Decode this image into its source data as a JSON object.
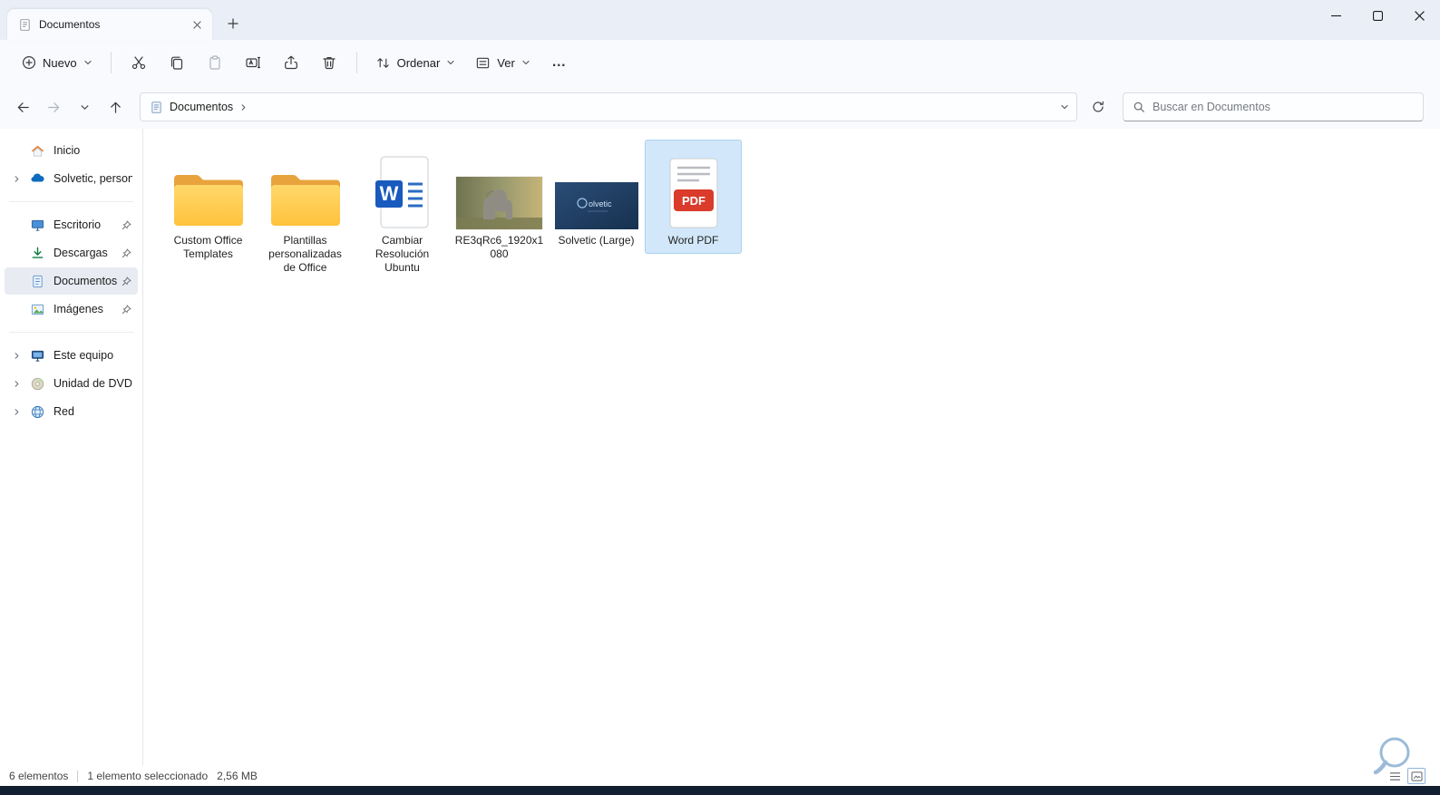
{
  "window": {
    "tab_title": "Documentos"
  },
  "toolbar": {
    "new_label": "Nuevo",
    "sort_label": "Ordenar",
    "view_label": "Ver",
    "more_label": "…"
  },
  "nav": {
    "breadcrumb": "Documentos",
    "search_placeholder": "Buscar en Documentos"
  },
  "sidebar": {
    "items": [
      {
        "label": "Inicio",
        "icon": "home-icon",
        "pinned": false
      },
      {
        "label": "Solvetic, personal",
        "icon": "onedrive-cloud-icon",
        "pinned": false
      },
      {
        "label": "Escritorio",
        "icon": "desktop-icon",
        "pinned": true
      },
      {
        "label": "Descargas",
        "icon": "downloads-icon",
        "pinned": true
      },
      {
        "label": "Documentos",
        "icon": "documents-icon",
        "pinned": true,
        "selected": true
      },
      {
        "label": "Imágenes",
        "icon": "pictures-icon",
        "pinned": true
      },
      {
        "label": "Este equipo",
        "icon": "this-pc-icon",
        "pinned": false
      },
      {
        "label": "Unidad de DVD (D:)",
        "icon": "dvd-drive-icon",
        "pinned": false
      },
      {
        "label": "Red",
        "icon": "network-icon",
        "pinned": false
      }
    ]
  },
  "files": [
    {
      "name": "Custom Office Templates",
      "type": "folder"
    },
    {
      "name": "Plantillas personalizadas de Office",
      "type": "folder"
    },
    {
      "name": "Cambiar Resolución Ubuntu",
      "type": "word-document",
      "badge": "W"
    },
    {
      "name": "RE3qRc6_1920x1080",
      "type": "image"
    },
    {
      "name": "Solvetic (Large)",
      "type": "image",
      "thumbnail_text": "olvetic"
    },
    {
      "name": "Word PDF",
      "type": "pdf",
      "badge": "PDF",
      "selected": true
    }
  ],
  "statusbar": {
    "item_count": "6 elementos",
    "selection": "1 elemento seleccionado",
    "selection_size": "2,56 MB"
  },
  "colors": {
    "selection_fill": "#d2e8fa",
    "folder_yellow": "#ffc63d",
    "pdf_red": "#da3b2b",
    "word_blue": "#185abd",
    "accent_blue": "#0067c0"
  }
}
